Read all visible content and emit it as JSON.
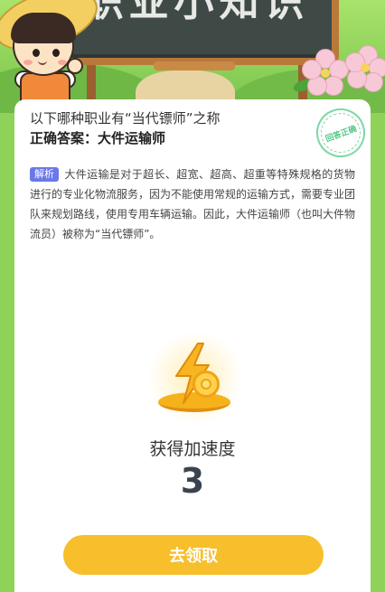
{
  "banner": {
    "title": "职业小知识"
  },
  "quiz": {
    "question": "以下哪种职业有“当代镖师”之称",
    "answer_prefix": "正确答案：",
    "answer": "大件运输师",
    "stamp_text": "回答正确"
  },
  "explanation": {
    "tag": "解析",
    "text": "大件运输是对于超长、超宽、超高、超重等特殊规格的货物进行的专业化物流服务，因为不能使用常规的运输方式，需要专业团队来规划路线，使用专用车辆运输。因此，大件运输师（也叫大件物流员）被称为“当代镖师”。"
  },
  "reward": {
    "label": "获得加速度",
    "value": "3",
    "icon": "lightning-coin-icon"
  },
  "actions": {
    "claim_label": "去领取"
  },
  "colors": {
    "accent": "#f7bf2c",
    "tag": "#6b78e8",
    "stamp": "#55c585",
    "grass": "#8ed25a"
  }
}
